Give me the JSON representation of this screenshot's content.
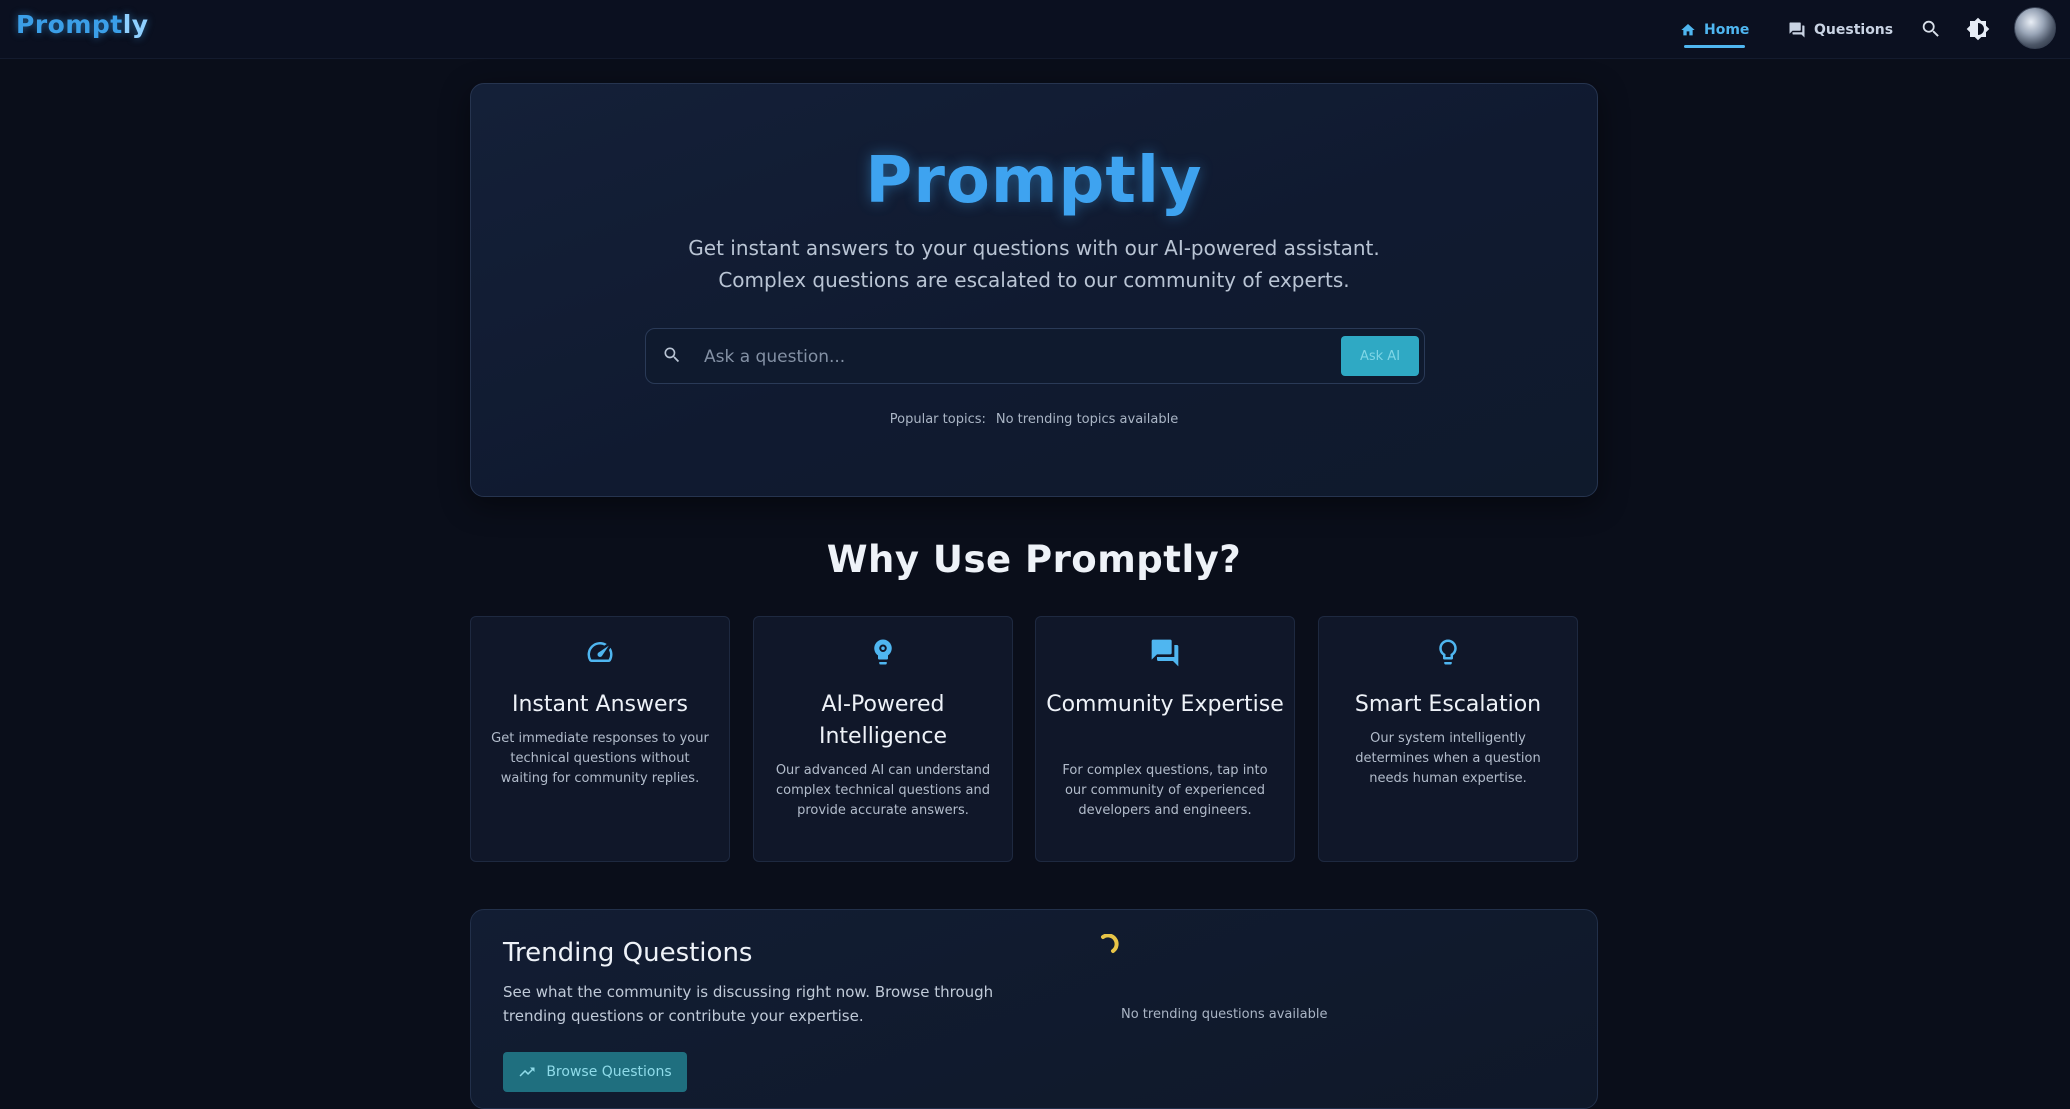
{
  "nav": {
    "brand_main": "Prompt",
    "brand_tail": "ly",
    "home_label": "Home",
    "questions_label": "Questions"
  },
  "hero": {
    "title": "Promptly",
    "subtitle_line1": "Get instant answers to your questions with our AI-powered assistant.",
    "subtitle_line2": "Complex questions are escalated to our community of experts.",
    "search_placeholder": "Ask a question...",
    "ask_button": "Ask AI",
    "popular_label": "Popular topics:",
    "popular_value": "No trending topics available"
  },
  "why": {
    "title": "Why Use Promptly?",
    "cards": [
      {
        "icon": "speedometer-icon",
        "title": "Instant Answers",
        "desc": "Get immediate responses to your technical questions without waiting for community replies."
      },
      {
        "icon": "ai-brain-icon",
        "title": "AI-Powered Intelligence",
        "desc": "Our advanced AI can understand complex technical questions and provide accurate answers."
      },
      {
        "icon": "forum-icon",
        "title": "Community Expertise",
        "desc": "For complex questions, tap into our community of experienced developers and engineers."
      },
      {
        "icon": "lightbulb-icon",
        "title": "Smart Escalation",
        "desc": "Our system intelligently determines when a question needs human expertise."
      }
    ]
  },
  "trending": {
    "title": "Trending Questions",
    "desc": "See what the community is discussing right now. Browse through trending questions or contribute your expertise.",
    "browse_button": "Browse Questions",
    "empty_text": "No trending questions available"
  },
  "colors": {
    "accent": "#3ea3f0",
    "button_teal": "#2fa9c4",
    "background": "#0a0e1a"
  }
}
